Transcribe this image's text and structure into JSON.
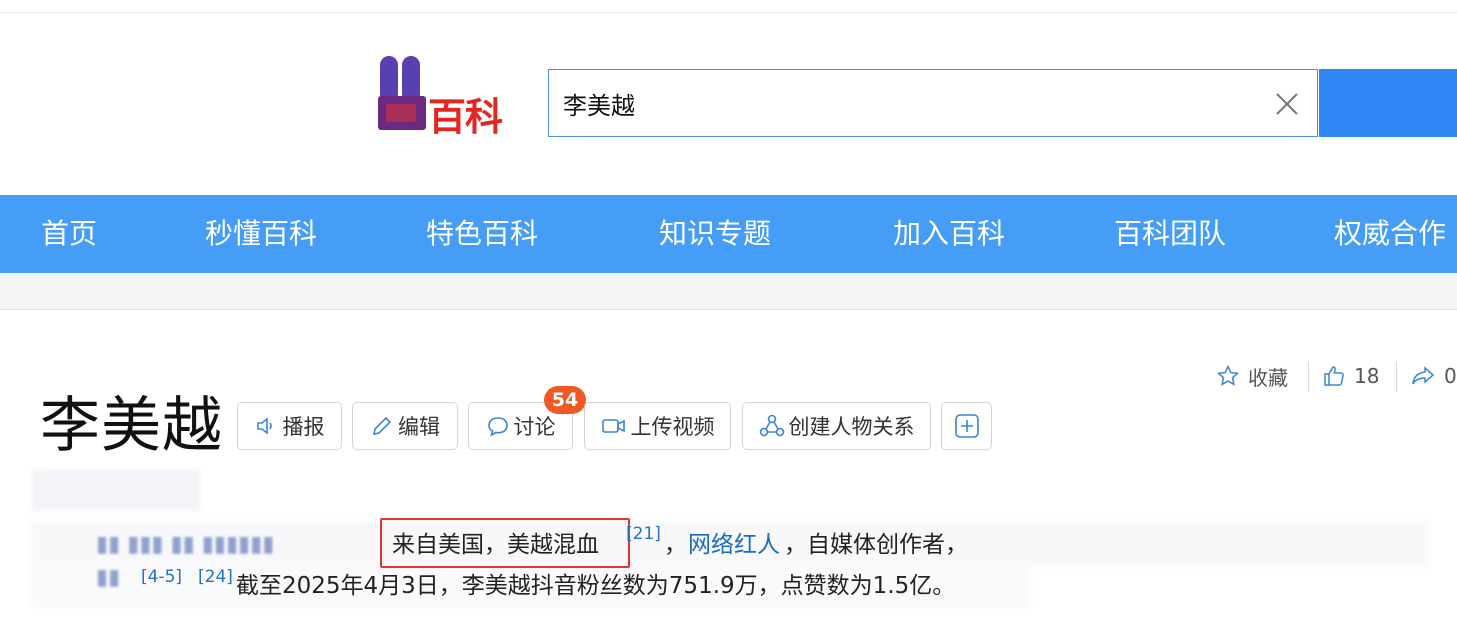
{
  "header": {
    "logo_text": "百科",
    "search": {
      "value": "李美越"
    }
  },
  "nav": {
    "items": [
      {
        "label": "首页"
      },
      {
        "label": "秒懂百科"
      },
      {
        "label": "特色百科"
      },
      {
        "label": "知识专题"
      },
      {
        "label": "加入百科"
      },
      {
        "label": "百科团队"
      },
      {
        "label": "权威合作"
      }
    ]
  },
  "entry": {
    "title": "李美越",
    "toolbar": {
      "broadcast": "播报",
      "edit": "编辑",
      "discuss": "讨论",
      "discuss_count": "54",
      "upload_video": "上传视频",
      "create_relation": "创建人物关系"
    },
    "actions": {
      "favorite": "收藏",
      "like_count": "18",
      "share_count": "0"
    },
    "summary": {
      "highlighted": "来自美国，美越混血",
      "ref_21": "[21]",
      "sep1": "，",
      "link_label": "网络红人",
      "line1_rest": "，自媒体创作者，",
      "ref_4_5": "[4-5]",
      "ref_24": "[24]",
      "line2": "截至2025年4月3日，李美越抖音粉丝数为751.9万，点赞数为1.5亿。"
    }
  },
  "colors": {
    "nav_bg": "#459df5",
    "search_border": "#4c8ed8",
    "search_button": "#2e87f5",
    "badge": "#ef5a24",
    "highlight": "#e8322d",
    "link": "#1b6bc0"
  }
}
